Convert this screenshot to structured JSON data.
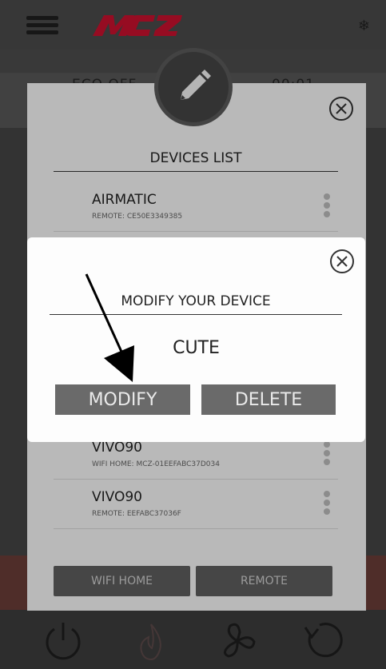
{
  "app": {
    "brand": "MCZ"
  },
  "header": {
    "icons": [
      "menu-icon",
      "snowflake-icon"
    ]
  },
  "background_tabs": {
    "left_label": "ECO OFF",
    "right_label": "00:01"
  },
  "devices_panel": {
    "title": "DEVICES LIST",
    "devices": [
      {
        "name": "AIRMATIC",
        "detail": "REMOTE: CE50E3349385"
      },
      {
        "name": "VIVO90",
        "detail": "WIFI HOME: MCZ-01EEFABC37D034"
      },
      {
        "name": "VIVO90",
        "detail": "REMOTE: EEFABC37036F"
      }
    ],
    "buttons": {
      "wifi_home": "WIFI HOME",
      "remote": "REMOTE"
    }
  },
  "modal": {
    "title": "MODIFY YOUR DEVICE",
    "device_name": "CUTE",
    "buttons": {
      "modify": "MODIFY",
      "delete": "DELETE"
    }
  },
  "bottom_nav": {
    "icons": [
      "power-icon",
      "flame-icon",
      "fan-icon",
      "refresh-icon"
    ]
  },
  "colors": {
    "brand_red": "#c8102e",
    "button_gray": "#6a6a6a",
    "panel_bg": "#f7f7f7"
  }
}
